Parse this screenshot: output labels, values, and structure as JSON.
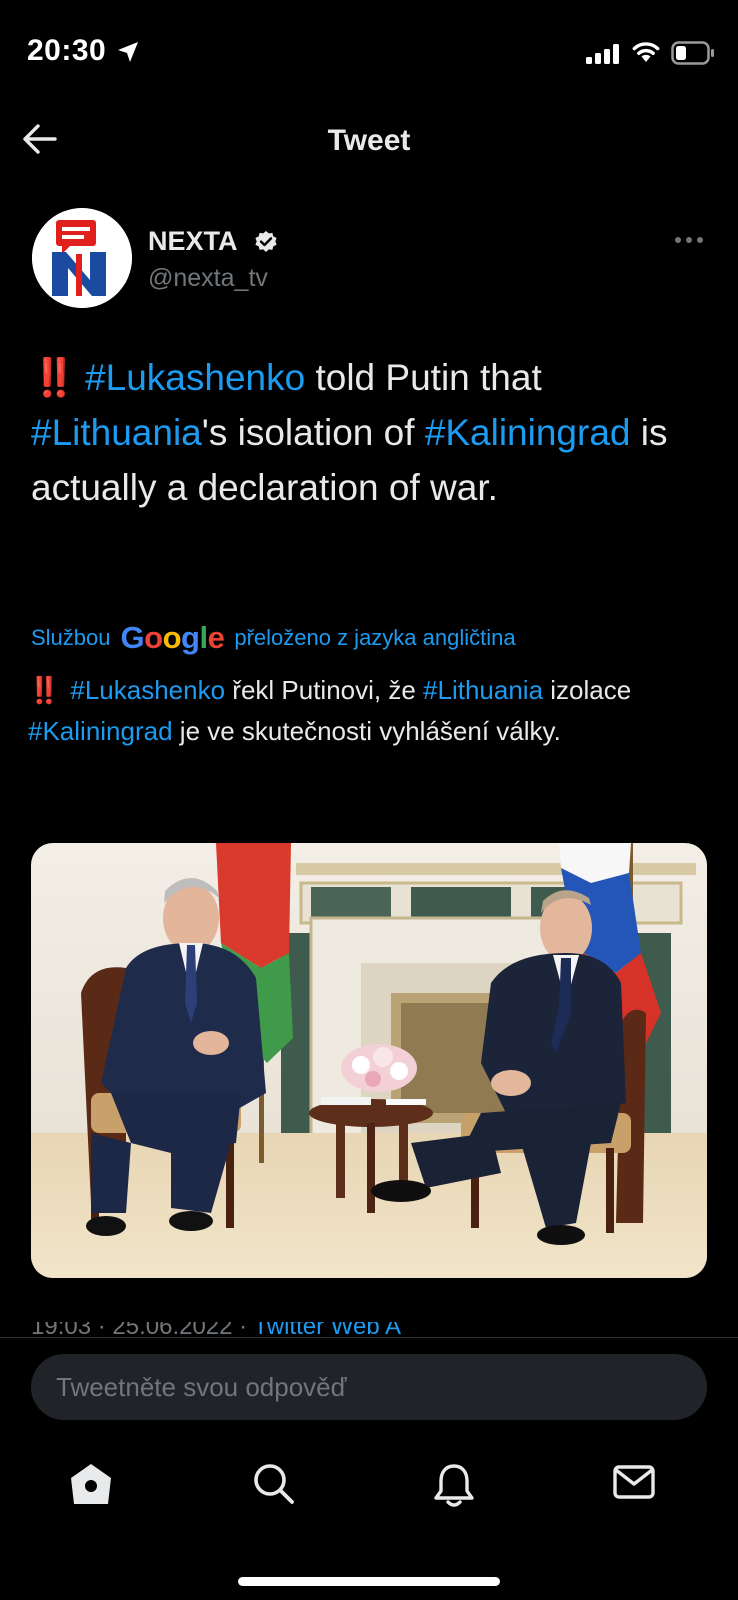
{
  "status_bar": {
    "time": "20:30"
  },
  "header": {
    "title": "Tweet"
  },
  "author": {
    "name": "NEXTA",
    "handle": "@nexta_tv",
    "verified": true
  },
  "tweet": {
    "segments": [
      {
        "type": "emoji",
        "text": "‼️"
      },
      {
        "type": "hashtag",
        "text": "#Lukashenko"
      },
      {
        "type": "text",
        "text": " told Putin that "
      },
      {
        "type": "hashtag",
        "text": "#Lithuania"
      },
      {
        "type": "text",
        "text": "'s isolation of "
      },
      {
        "type": "hashtag",
        "text": "#Kaliningrad"
      },
      {
        "type": "text",
        "text": " is actually a declaration of war."
      }
    ]
  },
  "translation": {
    "prefix": "Službou",
    "provider": "Google",
    "suffix": "přeloženo z jazyka angličtina",
    "segments": [
      {
        "type": "emoji",
        "text": "‼️"
      },
      {
        "type": "hashtag",
        "text": "#Lukashenko"
      },
      {
        "type": "text",
        "text": " řekl Putinovi, že "
      },
      {
        "type": "hashtag",
        "text": "#Lithuania"
      },
      {
        "type": "text",
        "text": " izolace "
      },
      {
        "type": "hashtag",
        "text": "#Kaliningrad"
      },
      {
        "type": "text",
        "text": " je ve skutečnosti vyhlášení války."
      }
    ]
  },
  "meta_partial": {
    "time_date": "19:03 · 25.06.2022",
    "sep": " · ",
    "source": "Twitter Web A"
  },
  "reply": {
    "placeholder": "Tweetněte svou odpověď"
  },
  "colors": {
    "accent": "#1d9bf0",
    "background": "#000000",
    "alert_red": "#e0201c"
  }
}
